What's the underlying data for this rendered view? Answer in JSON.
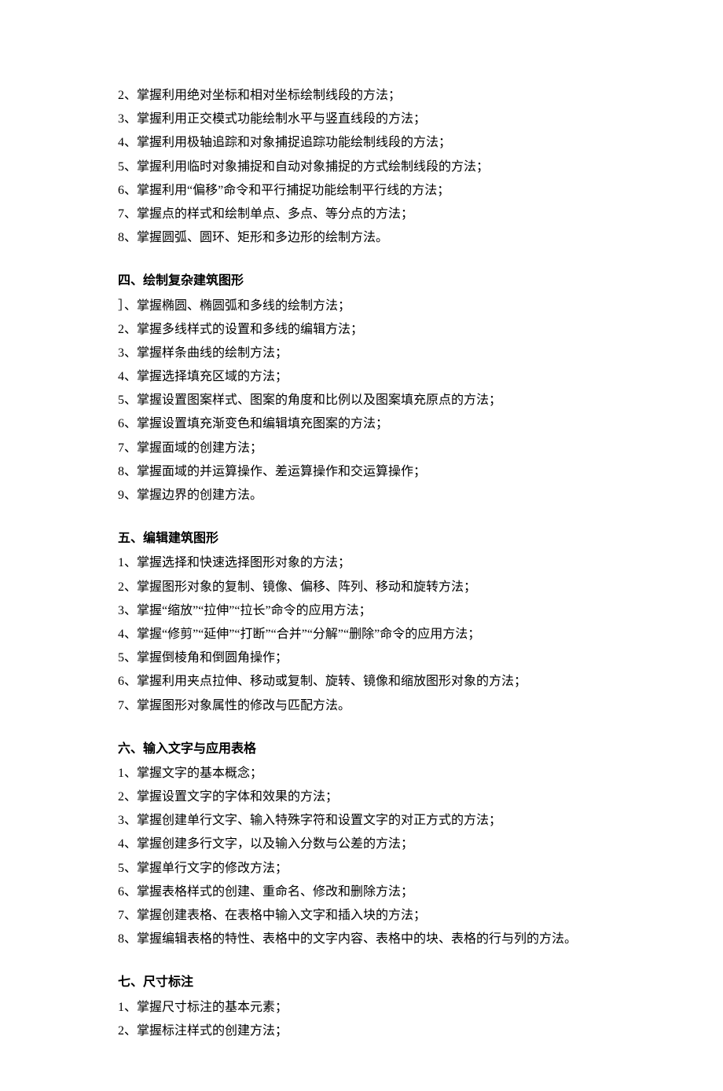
{
  "sections": [
    {
      "heading": null,
      "items": [
        "2、掌握利用绝对坐标和相对坐标绘制线段的方法；",
        "3、掌握利用正交模式功能绘制水平与竖直线段的方法；",
        "4、掌握利用极轴追踪和对象捕捉追踪功能绘制线段的方法；",
        "5、掌握利用临时对象捕捉和自动对象捕捉的方式绘制线段的方法；",
        "6、掌握利用“偏移”命令和平行捕捉功能绘制平行线的方法；",
        "7、掌握点的样式和绘制单点、多点、等分点的方法；",
        "8、掌握圆弧、圆环、矩形和多边形的绘制方法。"
      ]
    },
    {
      "heading": "四、绘制复杂建筑图形",
      "items": [
        "］、掌握椭圆、椭圆弧和多线的绘制方法；",
        "2、掌握多线样式的设置和多线的编辑方法；",
        "3、掌握样条曲线的绘制方法；",
        "4、掌握选择填充区域的方法；",
        "5、掌握设置图案样式、图案的角度和比例以及图案填充原点的方法；",
        "6、掌握设置填充渐变色和编辑填充图案的方法；",
        "7、掌握面域的创建方法；",
        "8、掌握面域的并运算操作、差运算操作和交运算操作；",
        "9、掌握边界的创建方法。"
      ]
    },
    {
      "heading": "五、编辑建筑图形",
      "items": [
        "1、掌握选择和快速选择图形对象的方法；",
        "2、掌握图形对象的复制、镜像、偏移、阵列、移动和旋转方法；",
        "3、掌握“缩放”“拉伸”“拉长”命令的应用方法；",
        "4、掌握“修剪”“延伸”“打断”“合并”“分解”“删除”命令的应用方法；",
        "5、掌握倒棱角和倒圆角操作；",
        "6、掌握利用夹点拉伸、移动或复制、旋转、镜像和缩放图形对象的方法；",
        "7、掌握图形对象属性的修改与匹配方法。"
      ]
    },
    {
      "heading": "六、输入文字与应用表格",
      "items": [
        "1、掌握文字的基本概念；",
        "2、掌握设置文字的字体和效果的方法；",
        "3、掌握创建单行文字、输入特殊字符和设置文字的对正方式的方法；",
        "4、掌握创建多行文字，以及输入分数与公差的方法；",
        "5、掌握单行文字的修改方法；",
        "6、掌握表格样式的创建、重命名、修改和删除方法；",
        "7、掌握创建表格、在表格中输入文字和插入块的方法；",
        "8、掌握编辑表格的特性、表格中的文字内容、表格中的块、表格的行与列的方法。"
      ]
    },
    {
      "heading": "七、尺寸标注",
      "items": [
        "1、掌握尺寸标注的基本元素；",
        "2、掌握标注样式的创建方法；"
      ]
    }
  ]
}
